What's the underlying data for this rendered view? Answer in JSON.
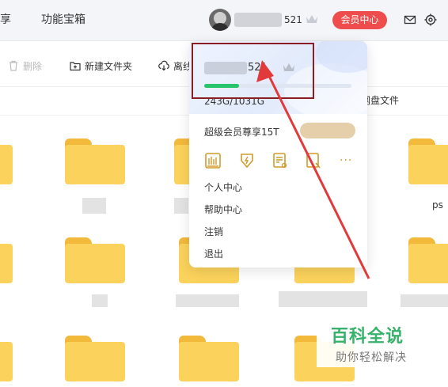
{
  "topbar": {
    "nav_share": "享",
    "nav_tools": "功能宝箱",
    "username_suffix": "521",
    "vip_center": "会员中心"
  },
  "toolbar": {
    "delete": "删除",
    "new_folder": "新建文件夹",
    "offline": "离线",
    "disk_files": "网盘文件"
  },
  "files": {
    "ps_label": "ps"
  },
  "popover": {
    "username_suffix": "521",
    "storage": "243G/1031G",
    "storage_used_fraction": 0.236,
    "vip_promo": "超级会员尊享15T",
    "menu": [
      "个人中心",
      "帮助中心",
      "注销",
      "退出"
    ],
    "icons": [
      "storage-icon",
      "speed-icon",
      "document-icon",
      "scan-icon",
      "more-icon"
    ],
    "more": "···"
  },
  "colors": {
    "vip_red": "#ef4d4d",
    "folder": "#fbd25b",
    "progress": "#27c46e",
    "annotation": "#e23a3a",
    "watermark": "#37b26b"
  },
  "watermark": {
    "title": "百科全说",
    "subtitle": "助你轻松解决"
  }
}
